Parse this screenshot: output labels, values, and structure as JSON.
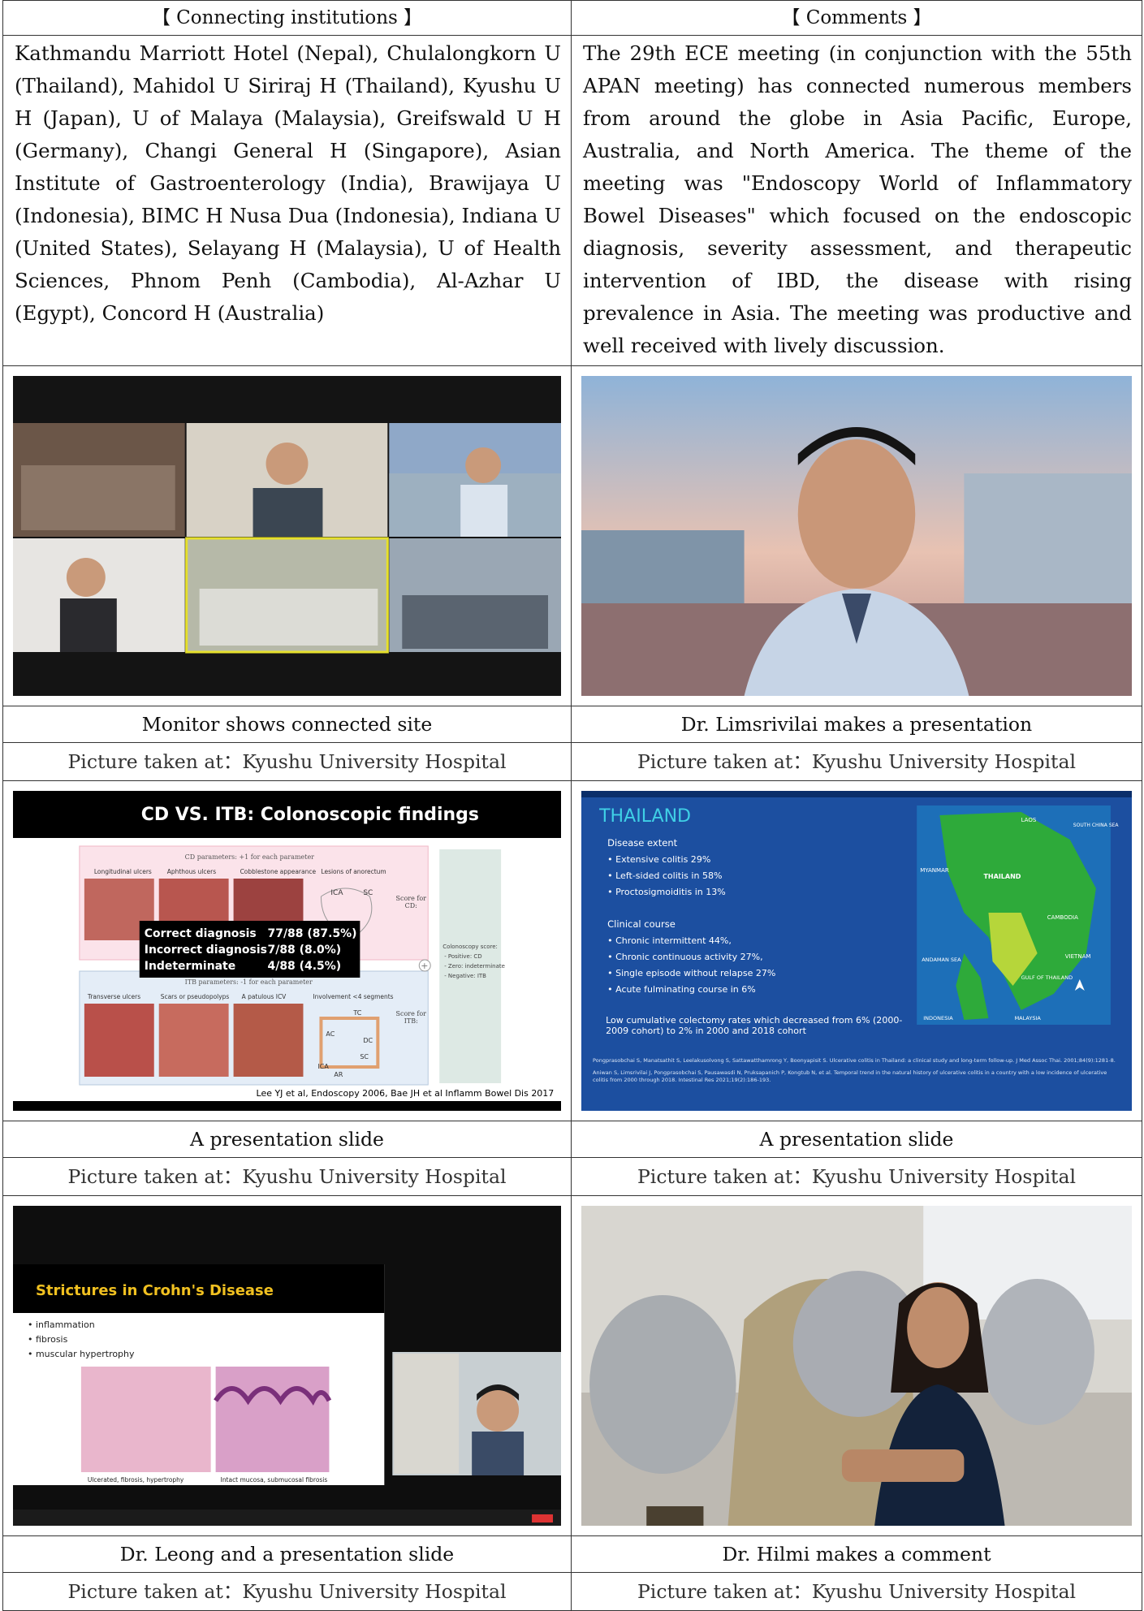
{
  "header": {
    "institutions_label": "【 Connecting institutions 】",
    "comments_label": "【 Comments 】"
  },
  "institutions_text": "Kathmandu Marriott Hotel (Nepal), Chulalongkorn U (Thailand), Mahidol U Siriraj H (Thailand), Kyushu U H (Japan), U of Malaya (Malaysia), Greifswald U H (Germany), Changi General H (Singapore), Asian Institute of Gastroenterology (India), Brawijaya U (Indonesia), BIMC H Nusa Dua (Indonesia), Indiana U (United States), Selayang H (Malaysia), U of Health Sciences, Phnom Penh (Cambodia), Al-Azhar U (Egypt), Concord H (Australia)",
  "comments_text": "The 29th ECE meeting (in conjunction with the 55th APAN meeting) has connected numerous members from around the globe in Asia Pacific, Europe, Australia, and North America. The theme of the meeting was \"Endoscopy World of Inflammatory Bowel Diseases\" which focused on the endoscopic diagnosis, severity assessment, and therapeutic intervention of IBD, the disease with rising prevalence in Asia. The meeting was productive and well received with lively discussion.",
  "photos": [
    {
      "caption": "Monitor shows connected site",
      "source": "Picture taken at：Kyushu University Hospital"
    },
    {
      "caption": "Dr. Limsrivilai makes a presentation",
      "source": "Picture taken at：Kyushu University Hospital"
    },
    {
      "caption": "A presentation slide",
      "source": "Picture taken at：Kyushu University Hospital"
    },
    {
      "caption": "A presentation slide",
      "source": "Picture taken at：Kyushu University Hospital"
    },
    {
      "caption": "Dr. Leong and a presentation slide",
      "source": "Picture taken at：Kyushu University Hospital"
    },
    {
      "caption": "Dr. Hilmi makes a comment",
      "source": "Picture taken at：Kyushu University Hospital"
    }
  ],
  "slides": {
    "cd_itb": {
      "title": "CD VS. ITB: Colonoscopic findings",
      "cd_params": "CD parameters: +1 for each parameter",
      "cd_cols": [
        "Longitudinal ulcers",
        "Aphthous ulcers",
        "Cobblestone appearance",
        "Lesions of anorectum"
      ],
      "itb_params": "ITB parameters: -1 for each parameter",
      "itb_cols": [
        "Transverse ulcers",
        "Scars or pseudopolyps",
        "A patulous ICV",
        "Involvement <4 segments"
      ],
      "score_cd": "Score for CD:",
      "score_itb": "Score for ITB:",
      "colonoscopy_score": [
        "Colonoscopy score:",
        "- Positive: CD",
        "- Zero: indeterminate",
        "- Negative: ITB"
      ],
      "results": [
        {
          "label": "Correct diagnosis",
          "value": "77/88 (87.5%)"
        },
        {
          "label": "Incorrect diagnosis",
          "value": "7/88 (8.0%)"
        },
        {
          "label": "Indeterminate",
          "value": "4/88 (4.5%)"
        }
      ],
      "segments": [
        "ICA",
        "SC",
        "TC",
        "AC",
        "DC",
        "SC",
        "ICA",
        "AR"
      ],
      "reference": "Lee YJ et al, Endoscopy 2006, Bae JH et al Inflamm Bowel Dis 2017"
    },
    "thailand": {
      "title": "THAILAND",
      "extent_heading": "Disease extent",
      "extent_items": [
        "Extensive colitis 29%",
        "Left-sided colitis in 58%",
        "Proctosigmoiditis in 13%"
      ],
      "course_heading": "Clinical course",
      "course_items": [
        "Chronic intermittent 44%,",
        "Chronic continuous activity 27%,",
        "Single episode without relapse 27%",
        "Acute fulminating course in 6%"
      ],
      "colectomy": "Low cumulative colectomy rates which decreased from 6% (2000-2009 cohort) to 2% in 2000 and 2018 cohort",
      "map_labels": [
        "LAOS",
        "MYANMAR",
        "THAILAND",
        "CAMBODIA",
        "VIETNAM",
        "ANDAMAN SEA",
        "GULF OF THAILAND",
        "INDONESIA",
        "MALAYSIA",
        "SOUTH CHINA SEA"
      ],
      "ref1": "Pongprasobchai S, Manatsathit S, Leelakusolvong S, Sattawatthamrong Y, Boonyapisit S. Ulcerative colitis in Thailand: a clinical study and long-term follow-up. J Med Assoc Thai. 2001;84(9):1281-8.",
      "ref2": "Aniwan S, Limsrivilai J, Pongprasobchai S, Pausawasdi N, Pruksapanich P, Kongtub N, et al. Temporal trend in the natural history of ulcerative colitis in a country with a low incidence of ulcerative colitis from 2000 through 2018. Intestinal Res 2021;19(2):186-193."
    },
    "crohn": {
      "title": "Strictures in Crohn's Disease",
      "bullets": [
        "inflammation",
        "fibrosis",
        "muscular hypertrophy"
      ],
      "img_captions": [
        "Ulcerated, fibrosis, hypertrophy",
        "Intact mucosa, submucosal fibrosis"
      ]
    }
  }
}
